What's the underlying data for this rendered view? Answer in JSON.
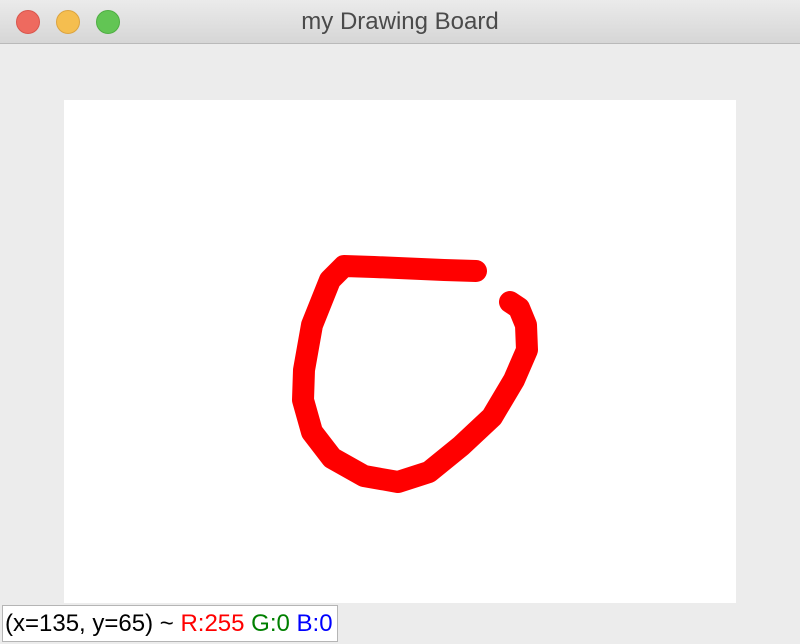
{
  "window": {
    "title": "my Drawing Board"
  },
  "status": {
    "coords": "(x=135, y=65) ~",
    "r": "R:255",
    "g": "G:0",
    "b": "B:0"
  },
  "colors": {
    "stroke": "#ff0000",
    "r_label": "#ff0000",
    "g_label": "#008000",
    "b_label": "#0000ff"
  },
  "drawing": {
    "tool": "brush",
    "stroke_color": "red"
  }
}
